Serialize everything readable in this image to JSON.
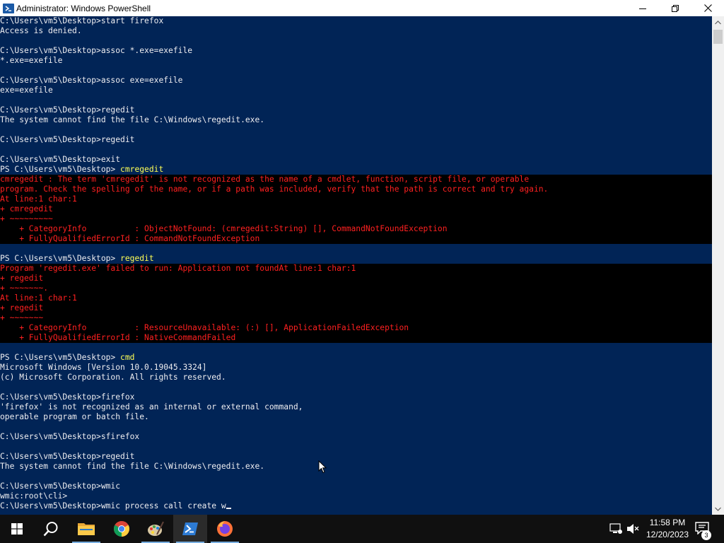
{
  "window": {
    "title": "Administrator: Windows PowerShell",
    "controls": [
      "minimize-icon",
      "maximize-icon",
      "close-icon"
    ]
  },
  "console": {
    "background": "#012456",
    "error_background": "#000000",
    "error_color": "#ff2020",
    "command_color": "#ffff55",
    "lines": [
      {
        "text": "C:\\Users\\vm5\\Desktop>start firefox",
        "style": "normal"
      },
      {
        "text": "Access is denied.",
        "style": "normal"
      },
      {
        "text": "",
        "style": "normal"
      },
      {
        "text": "C:\\Users\\vm5\\Desktop>assoc *.exe=exefile",
        "style": "normal"
      },
      {
        "text": "*.exe=exefile",
        "style": "normal"
      },
      {
        "text": "",
        "style": "normal"
      },
      {
        "text": "C:\\Users\\vm5\\Desktop>assoc exe=exefile",
        "style": "normal"
      },
      {
        "text": "exe=exefile",
        "style": "normal"
      },
      {
        "text": "",
        "style": "normal"
      },
      {
        "text": "C:\\Users\\vm5\\Desktop>regedit",
        "style": "normal"
      },
      {
        "text": "The system cannot find the file C:\\Windows\\regedit.exe.",
        "style": "normal"
      },
      {
        "text": "",
        "style": "normal"
      },
      {
        "text": "C:\\Users\\vm5\\Desktop>regedit",
        "style": "normal"
      },
      {
        "text": "",
        "style": "normal"
      },
      {
        "text": "C:\\Users\\vm5\\Desktop>exit",
        "style": "normal"
      },
      {
        "text": "PS C:\\Users\\vm5\\Desktop> ",
        "cmd": "cmregedit",
        "style": "prompt"
      },
      {
        "text": "cmregedit : The term 'cmregedit' is not recognized as the name of a cmdlet, function, script file, or operable",
        "style": "error"
      },
      {
        "text": "program. Check the spelling of the name, or if a path was included, verify that the path is correct and try again.",
        "style": "error"
      },
      {
        "text": "At line:1 char:1",
        "style": "error"
      },
      {
        "text": "+ cmregedit",
        "style": "error"
      },
      {
        "text": "+ ~~~~~~~~~",
        "style": "error"
      },
      {
        "text": "    + CategoryInfo          : ObjectNotFound: (cmregedit:String) [], CommandNotFoundException",
        "style": "error"
      },
      {
        "text": "    + FullyQualifiedErrorId : CommandNotFoundException",
        "style": "error"
      },
      {
        "text": "",
        "style": "normal"
      },
      {
        "text": "PS C:\\Users\\vm5\\Desktop> ",
        "cmd": "regedit",
        "style": "prompt"
      },
      {
        "text": "Program 'regedit.exe' failed to run: Application not foundAt line:1 char:1",
        "style": "error"
      },
      {
        "text": "+ regedit",
        "style": "error"
      },
      {
        "text": "+ ~~~~~~~.",
        "style": "error"
      },
      {
        "text": "At line:1 char:1",
        "style": "error"
      },
      {
        "text": "+ regedit",
        "style": "error"
      },
      {
        "text": "+ ~~~~~~~",
        "style": "error"
      },
      {
        "text": "    + CategoryInfo          : ResourceUnavailable: (:) [], ApplicationFailedException",
        "style": "error"
      },
      {
        "text": "    + FullyQualifiedErrorId : NativeCommandFailed",
        "style": "error"
      },
      {
        "text": "",
        "style": "normal"
      },
      {
        "text": "PS C:\\Users\\vm5\\Desktop> ",
        "cmd": "cmd",
        "style": "prompt"
      },
      {
        "text": "Microsoft Windows [Version 10.0.19045.3324]",
        "style": "normal"
      },
      {
        "text": "(c) Microsoft Corporation. All rights reserved.",
        "style": "normal"
      },
      {
        "text": "",
        "style": "normal"
      },
      {
        "text": "C:\\Users\\vm5\\Desktop>firefox",
        "style": "normal"
      },
      {
        "text": "'firefox' is not recognized as an internal or external command,",
        "style": "normal"
      },
      {
        "text": "operable program or batch file.",
        "style": "normal"
      },
      {
        "text": "",
        "style": "normal"
      },
      {
        "text": "C:\\Users\\vm5\\Desktop>sfirefox",
        "style": "normal"
      },
      {
        "text": "",
        "style": "normal"
      },
      {
        "text": "C:\\Users\\vm5\\Desktop>regedit",
        "style": "normal"
      },
      {
        "text": "The system cannot find the file C:\\Windows\\regedit.exe.",
        "style": "normal"
      },
      {
        "text": "",
        "style": "normal"
      },
      {
        "text": "C:\\Users\\vm5\\Desktop>wmic",
        "style": "normal"
      },
      {
        "text": "wmic:root\\cli>",
        "style": "normal"
      },
      {
        "text": "C:\\Users\\vm5\\Desktop>wmic process call create w",
        "style": "input"
      }
    ]
  },
  "taskbar": {
    "items": [
      {
        "name": "start-button",
        "icon": "windows-logo-icon"
      },
      {
        "name": "search-button",
        "icon": "search-icon"
      },
      {
        "name": "file-explorer-button",
        "icon": "folder-icon"
      },
      {
        "name": "chrome-button",
        "icon": "chrome-icon"
      },
      {
        "name": "paint-button",
        "icon": "paint-icon"
      },
      {
        "name": "powershell-button",
        "icon": "powershell-icon",
        "active": true
      },
      {
        "name": "firefox-button",
        "icon": "firefox-icon"
      }
    ],
    "clock": {
      "time": "11:58 PM",
      "date": "12/20/2023"
    },
    "notification_count": "3"
  }
}
